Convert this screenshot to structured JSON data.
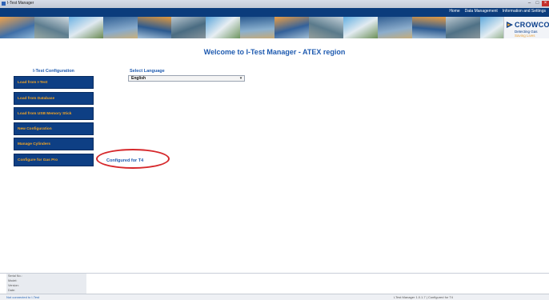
{
  "window": {
    "title": "I-Test Manager"
  },
  "nav": [
    "Home",
    "Data Management",
    "Information and Settings"
  ],
  "brand": {
    "name": "CROWCON",
    "tagline_1": "Detecting Gas",
    "tagline_2": "Saving Lives"
  },
  "main": {
    "heading": "Welcome to I-Test Manager - ATEX region"
  },
  "sidebar": {
    "title": "I-Test Configuration",
    "buttons": [
      "Load from I-Test",
      "Load from Database",
      "Load from USB Memory Stick",
      "New Configuration",
      "Manage Cylinders",
      "Configure for Gas Pro"
    ]
  },
  "language": {
    "label": "Select Language",
    "selected": "English"
  },
  "status_message": "Configured for T4",
  "info_panel": [
    "Serial No.:",
    "Model:",
    "Version:",
    "Date:"
  ],
  "statusbar": {
    "left": "Not connected to I-Test",
    "right": "I-Test Manager 1.0.1.7  |  Configured for T4"
  },
  "colors": {
    "banner": "#0b3c7c",
    "button_bg": "#0e3f84",
    "button_text": "#f5a623",
    "heading": "#1f5bb0",
    "callout": "#d6282b"
  }
}
